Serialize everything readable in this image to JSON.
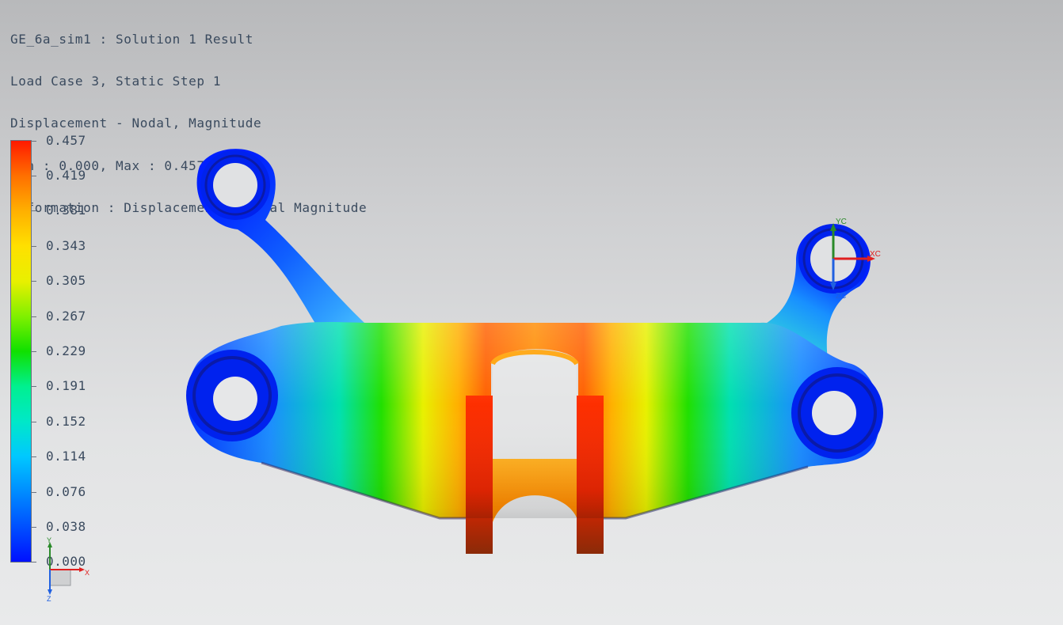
{
  "header": {
    "line1": "GE_6a_sim1 : Solution 1 Result",
    "line2": "Load Case 3, Static Step 1",
    "line3": "Displacement - Nodal, Magnitude",
    "line4": "Min : 0.000, Max : 0.457, mm",
    "line5": "Deformation : Displacement - Nodal Magnitude"
  },
  "legend": {
    "values": [
      "0.457",
      "0.419",
      "0.381",
      "0.343",
      "0.305",
      "0.267",
      "0.229",
      "0.191",
      "0.152",
      "0.114",
      "0.076",
      "0.038",
      "0.000"
    ]
  },
  "wcs_triad": {
    "x_label": "XC",
    "y_label": "YC",
    "z_label": "ZC"
  },
  "view_triad": {
    "x_label": "X",
    "y_label": "Y",
    "z_label": "Z"
  },
  "colors": {
    "min": "#0010ff",
    "max": "#ff1a00",
    "text": "#3a4a5e"
  }
}
